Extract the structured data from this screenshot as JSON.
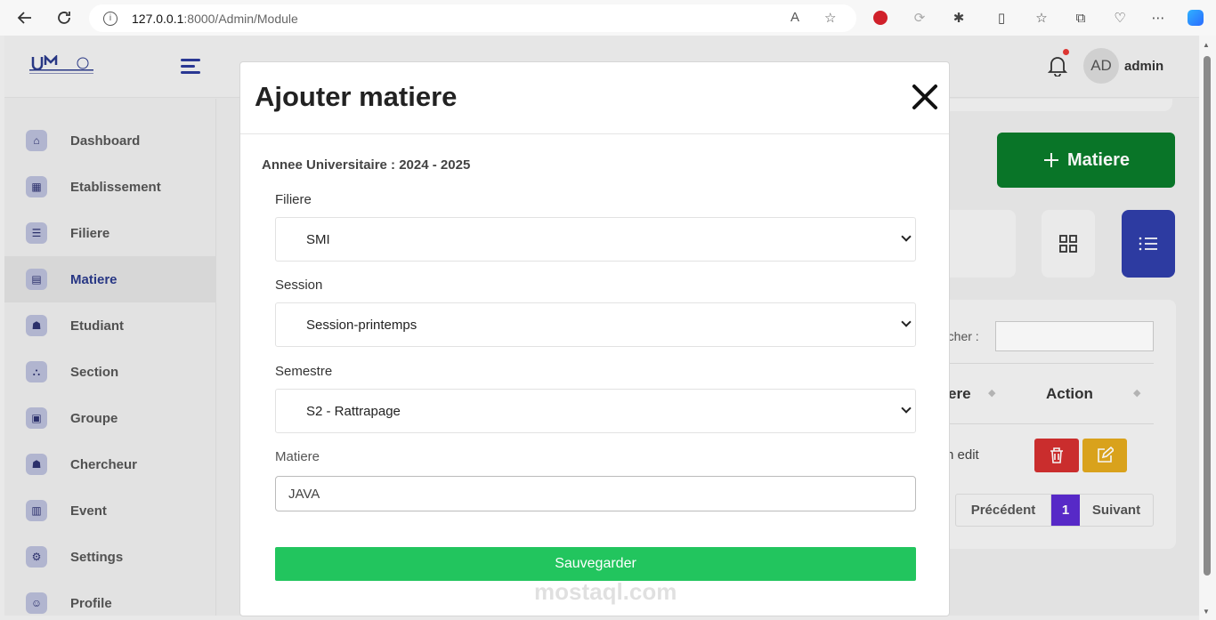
{
  "browser": {
    "url_host": "127.0.0.1",
    "url_path": ":8000/Admin/Module"
  },
  "header": {
    "avatar_initials": "AD",
    "username": "admin"
  },
  "sidebar": {
    "items": [
      {
        "label": "Dashboard",
        "icon": "home-icon"
      },
      {
        "label": "Etablissement",
        "icon": "building-icon"
      },
      {
        "label": "Filiere",
        "icon": "sliders-icon"
      },
      {
        "label": "Matiere",
        "icon": "book-icon",
        "active": true
      },
      {
        "label": "Etudiant",
        "icon": "student-icon"
      },
      {
        "label": "Section",
        "icon": "network-icon"
      },
      {
        "label": "Groupe",
        "icon": "group-icon"
      },
      {
        "label": "Chercheur",
        "icon": "researcher-icon"
      },
      {
        "label": "Event",
        "icon": "calendar-icon"
      },
      {
        "label": "Settings",
        "icon": "gear-icon"
      },
      {
        "label": "Profile",
        "icon": "user-icon"
      }
    ]
  },
  "background": {
    "add_button_label": "Matiere",
    "search_label": "rcher :",
    "col_partial": "ere",
    "col_action": "Action",
    "row_text": "n edit",
    "pagination": {
      "prev": "Précédent",
      "current": "1",
      "next": "Suivant"
    }
  },
  "modal": {
    "title": "Ajouter matiere",
    "year_label": "Annee Universitaire : 2024 - 2025",
    "filiere_label": "Filiere",
    "filiere_value": "SMI",
    "session_label": "Session",
    "session_value": "Session-printemps",
    "semestre_label": "Semestre",
    "semestre_value": "S2 - Rattrapage",
    "matiere_label": "Matiere",
    "matiere_value": "JAVA",
    "save_label": "Sauvegarder"
  },
  "watermark": "mostaql.com",
  "colors": {
    "primary": "#2a3a8a",
    "success": "#22c55e",
    "add_button": "#0a7a2a",
    "danger": "#d32f2f",
    "warning": "#e2a91e",
    "page_active": "#5b2bd0"
  }
}
